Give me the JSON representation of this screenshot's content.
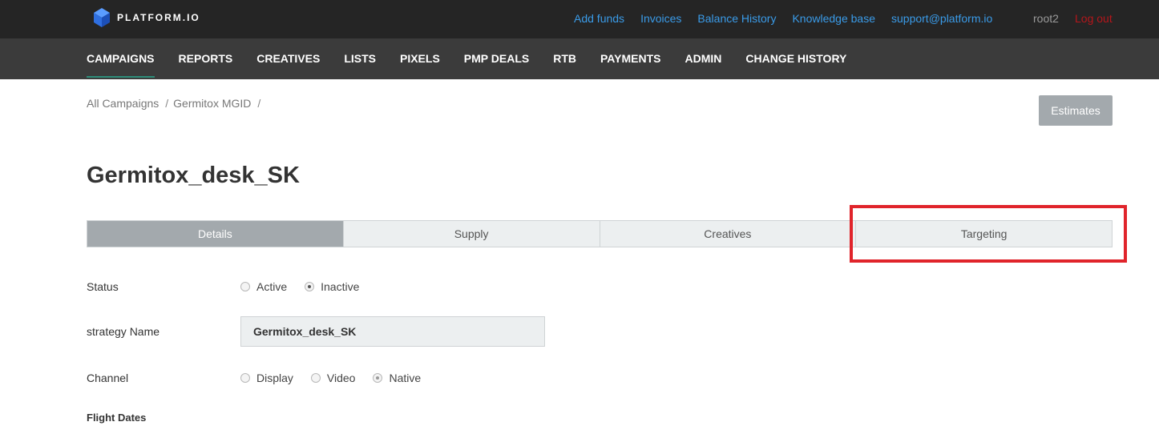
{
  "header": {
    "logo_text": "PLATFORM.IO",
    "links": [
      "Add funds",
      "Invoices",
      "Balance History",
      "Knowledge base",
      "support@platform.io"
    ],
    "user": "root2",
    "logout": "Log out"
  },
  "nav": {
    "items": [
      "CAMPAIGNS",
      "REPORTS",
      "CREATIVES",
      "LISTS",
      "PIXELS",
      "PMP DEALS",
      "RTB",
      "PAYMENTS",
      "ADMIN",
      "CHANGE HISTORY"
    ],
    "active": "CAMPAIGNS"
  },
  "breadcrumb": {
    "items": [
      "All Campaigns",
      "Germitox MGID"
    ],
    "separator": "/"
  },
  "estimates_button": "Estimates",
  "page_title": "Germitox_desk_SK",
  "tabs": {
    "items": [
      "Details",
      "Supply",
      "Creatives",
      "Targeting"
    ],
    "active": "Details",
    "highlighted": "Targeting"
  },
  "form": {
    "status": {
      "label": "Status",
      "options": [
        "Active",
        "Inactive"
      ],
      "selected": "Inactive"
    },
    "strategy_name": {
      "label": "strategy Name",
      "value": "Germitox_desk_SK"
    },
    "channel": {
      "label": "Channel",
      "options": [
        "Display",
        "Video",
        "Native"
      ],
      "selected": "Native"
    },
    "flight_dates": {
      "label": "Flight Dates"
    }
  },
  "colors": {
    "topbar": "#252525",
    "navbar": "#3b3b3b",
    "link": "#3a9be8",
    "logout": "#b5161b",
    "tab_active": "#a3a9ad",
    "highlight": "#e0242b",
    "logo_blue": "#2f6fe0"
  },
  "icons": [
    "logo-cube-icon",
    "radio-icon"
  ]
}
